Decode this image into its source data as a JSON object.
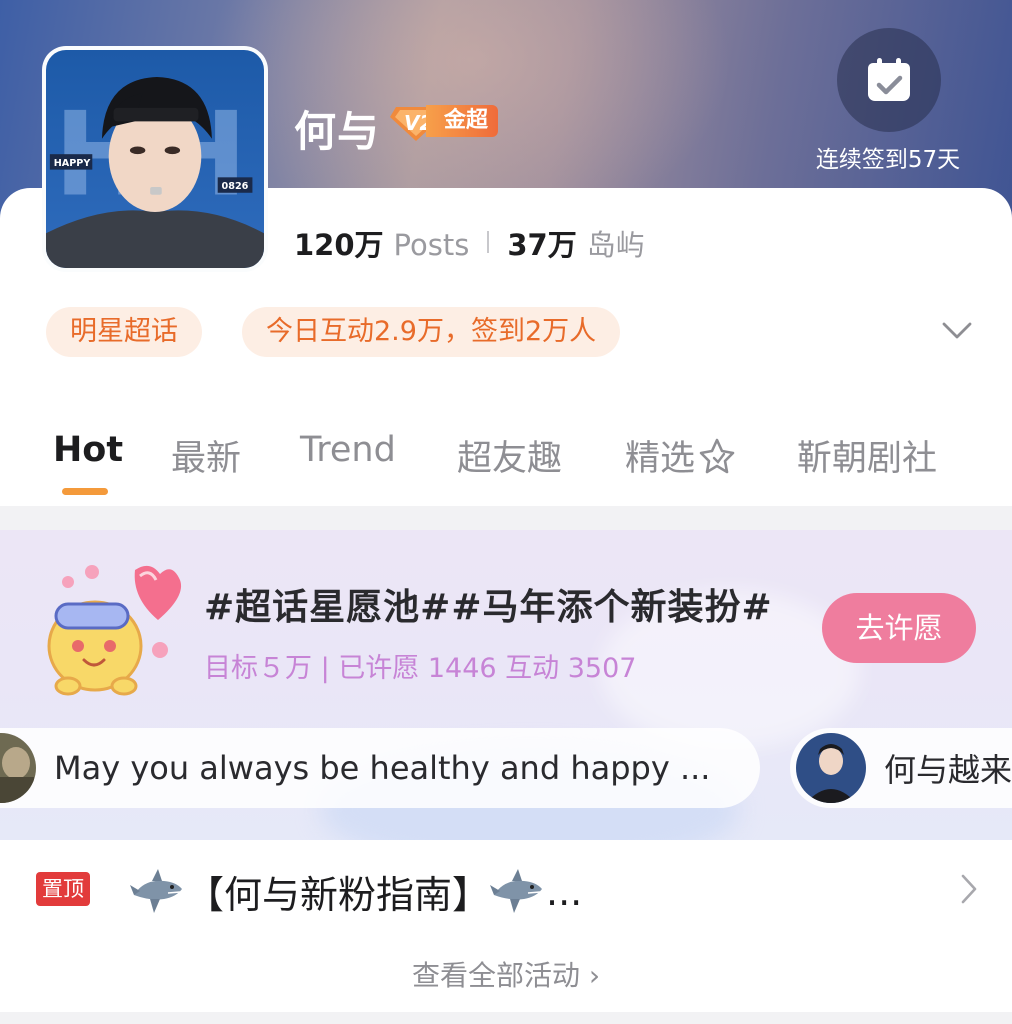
{
  "header": {
    "name": "何与",
    "level_badge": "金超",
    "checkin": "连续签到57天"
  },
  "avatar": {
    "tag_left": "HAPPY",
    "tag_right": "0826"
  },
  "stats": {
    "posts_num": "120万",
    "posts_label": "Posts",
    "islands_num": "37万",
    "islands_label": "岛屿"
  },
  "tags": {
    "category": "明星超话",
    "today": "今日互动2.9万，签到2万人"
  },
  "tabs": [
    "Hot",
    "最新",
    "Trend",
    "超友趣",
    "精选",
    "靳朝剧社"
  ],
  "wish": {
    "title": "#超话星愿池##马年添个新装扮#",
    "stats": "目标５万 | 已许愿 1446 互动 3507",
    "button": "去许愿",
    "messages": [
      "May you always be healthy and happy ...",
      "何与越来"
    ]
  },
  "pinned": {
    "badge": "置顶",
    "title_text": "【何与新粉指南】",
    "ellipsis": "..."
  },
  "view_all": "查看全部活动 ›",
  "colors": {
    "accent_orange": "#f49a3b",
    "tag_text": "#e86b2a",
    "tag_bg": "#fdeee4",
    "wish_button": "#ef7d9e",
    "wish_stats": "#c784d6",
    "pinned_badge": "#e23b3b"
  },
  "icons": [
    "calendar-check-icon",
    "sparkle-icon",
    "chevron-down-icon",
    "shark-icon",
    "chevron-right-icon",
    "level-gem-icon"
  ]
}
